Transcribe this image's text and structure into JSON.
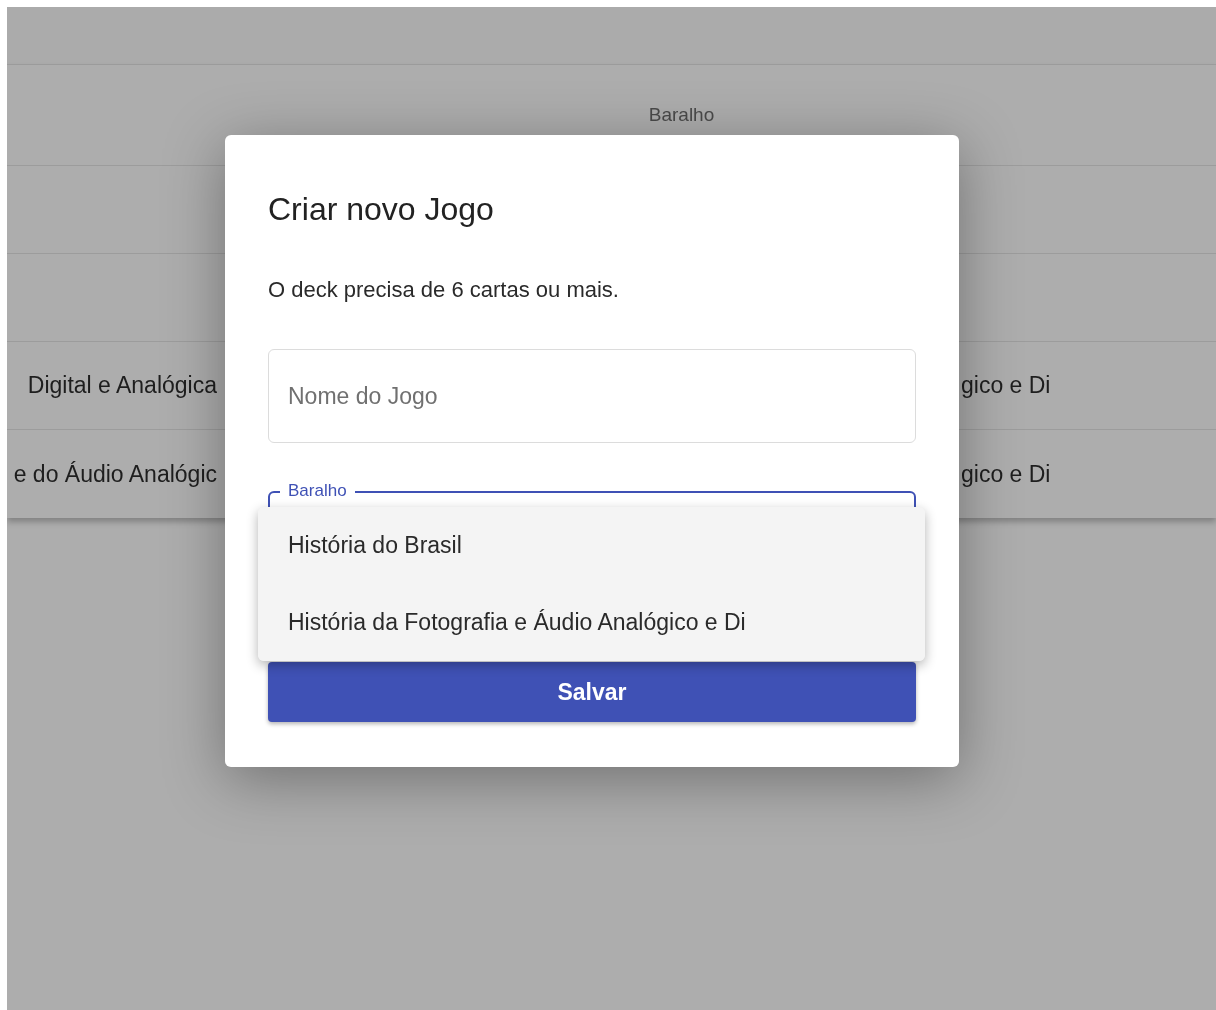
{
  "table": {
    "columns": [
      "Baralho"
    ],
    "rows": [
      {
        "cells": [
          "Digital e Analógica",
          "gico e Di"
        ]
      },
      {
        "cells": [
          "e do Áudio Analógic",
          "gico e Di"
        ]
      }
    ]
  },
  "dialog": {
    "title": "Criar novo Jogo",
    "message": "O deck precisa de 6 cartas ou mais.",
    "name_field": {
      "placeholder": "Nome do Jogo"
    },
    "deck_select": {
      "label": "Baralho",
      "expanded": true
    },
    "menu": [
      {
        "label": "História do Brasil",
        "selected": false
      },
      {
        "label": "História da Fotografia e Áudio Analógico e Di",
        "selected": false
      }
    ],
    "save_button": "Salvar"
  }
}
